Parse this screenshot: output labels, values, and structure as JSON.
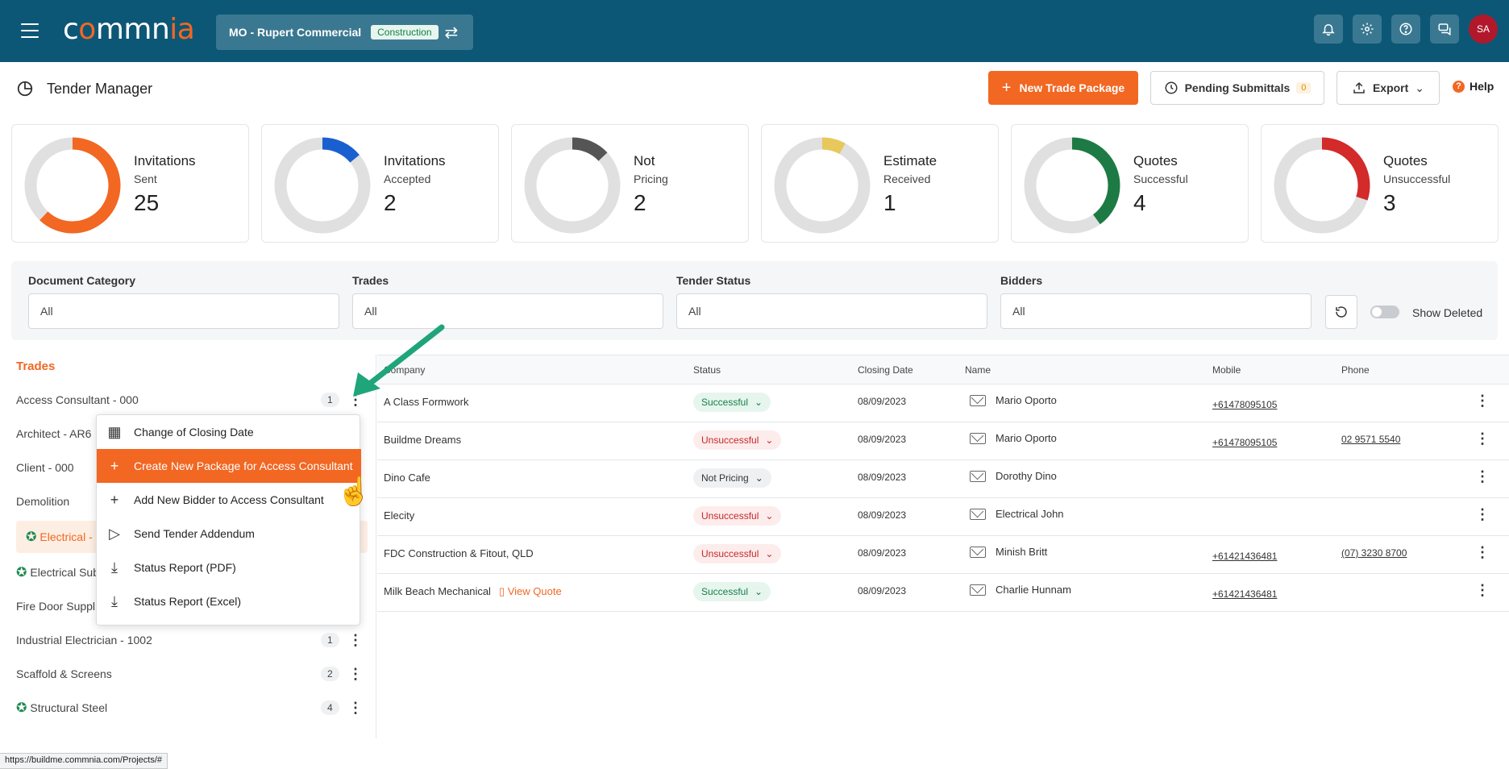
{
  "topbar": {
    "logo_main": "commnia",
    "project": "MO - Rupert Commercial",
    "project_badge": "Construction",
    "avatar": "SA",
    "icons": [
      "bell-icon",
      "gear-icon",
      "help-icon",
      "chat-icon"
    ]
  },
  "header": {
    "title": "Tender Manager",
    "new_package": "New Trade Package",
    "pending": "Pending Submittals",
    "pending_count": "0",
    "export": "Export",
    "help": "Help"
  },
  "stats": [
    {
      "t1": "Invitations",
      "t2": "Sent",
      "num": "25",
      "color": "#f26722",
      "fraction": 0.62
    },
    {
      "t1": "Invitations",
      "t2": "Accepted",
      "num": "2",
      "color": "#1a5fd0",
      "fraction": 0.14
    },
    {
      "t1": "Not",
      "t2": "Pricing",
      "num": "2",
      "color": "#555555",
      "fraction": 0.13
    },
    {
      "t1": "Estimate",
      "t2": "Received",
      "num": "1",
      "color": "#e8c85a",
      "fraction": 0.08
    },
    {
      "t1": "Quotes",
      "t2": "Successful",
      "num": "4",
      "color": "#1e7a44",
      "fraction": 0.4
    },
    {
      "t1": "Quotes",
      "t2": "Unsuccessful",
      "num": "3",
      "color": "#d32a2a",
      "fraction": 0.3
    }
  ],
  "filters": {
    "doc_category_label": "Document Category",
    "doc_category_value": "All",
    "trades_label": "Trades",
    "trades_value": "All",
    "tender_status_label": "Tender Status",
    "tender_status_value": "All",
    "bidders_label": "Bidders",
    "bidders_value": "All",
    "show_deleted": "Show Deleted"
  },
  "trades": {
    "title": "Trades",
    "items": [
      {
        "label": "Access Consultant - 000",
        "count": "1"
      },
      {
        "label": "Architect - AR6",
        "count": ""
      },
      {
        "label": "Client - 000",
        "count": ""
      },
      {
        "label": "Demolition",
        "count": ""
      },
      {
        "label": "Electrical -",
        "count": ""
      },
      {
        "label": "Electrical Sub",
        "count": ""
      },
      {
        "label": "Fire Door Suppl",
        "count": ""
      },
      {
        "label": "Industrial Electrician - 1002",
        "count": "1"
      },
      {
        "label": "Scaffold & Screens",
        "count": "2"
      },
      {
        "label": "Structural Steel",
        "count": "4"
      }
    ]
  },
  "table": {
    "headers": [
      "Company",
      "Status",
      "Closing Date",
      "Name",
      "Mobile",
      "Phone"
    ],
    "rows": [
      {
        "company": "A Class Formwork",
        "status": "Successful",
        "date": "08/09/2023",
        "name": "Mario Oporto",
        "mobile": "+61478095105",
        "phone": ""
      },
      {
        "company": "Buildme Dreams",
        "status": "Unsuccessful",
        "date": "08/09/2023",
        "name": "Mario Oporto",
        "mobile": "+61478095105",
        "phone": "02 9571 5540"
      },
      {
        "company": "Dino Cafe",
        "status": "Not Pricing",
        "date": "08/09/2023",
        "name": "Dorothy Dino",
        "mobile": "",
        "phone": ""
      },
      {
        "company": "Elecity",
        "status": "Unsuccessful",
        "date": "08/09/2023",
        "name": "Electrical John",
        "mobile": "",
        "phone": ""
      },
      {
        "company": "FDC Construction & Fitout, QLD",
        "status": "Unsuccessful",
        "date": "08/09/2023",
        "name": "Minish Britt",
        "mobile": "+61421436481",
        "phone": "(07) 3230 8700"
      },
      {
        "company": "Milk Beach Mechanical",
        "status": "Successful",
        "date": "08/09/2023",
        "name": "Charlie Hunnam",
        "mobile": "+61421436481",
        "phone": "",
        "view_quote": "View Quote"
      }
    ]
  },
  "menu": {
    "items": [
      "Change of Closing Date",
      "Create New Package for Access Consultant",
      "Add New Bidder to Access Consultant",
      "Send Tender Addendum",
      "Status Report (PDF)",
      "Status Report (Excel)"
    ]
  },
  "statusbar": {
    "url": "https://buildme.commnia.com/Projects/#"
  }
}
